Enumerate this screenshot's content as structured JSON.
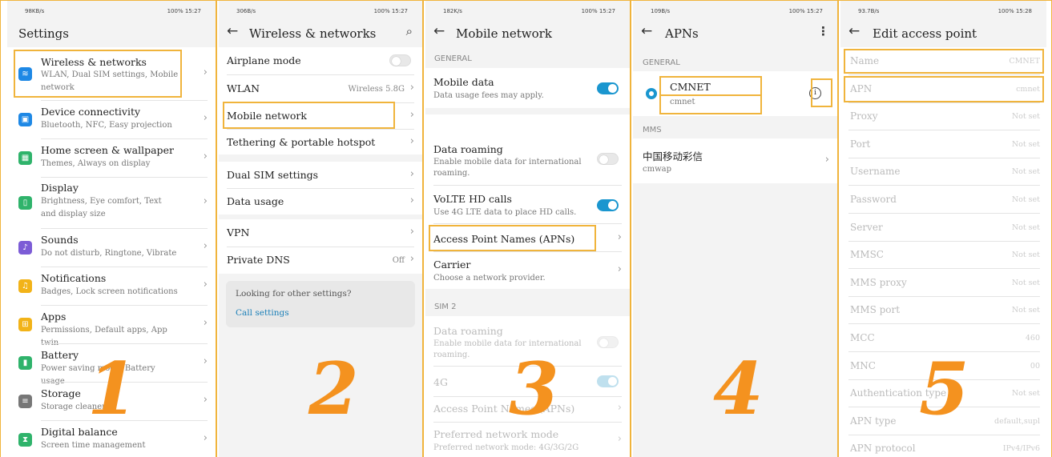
{
  "status_bars": [
    {
      "left": "98KB/s",
      "right": "100% 15:27"
    },
    {
      "left": "306B/s",
      "right": "100% 15:27"
    },
    {
      "left": "182K/s",
      "right": "100% 15:27"
    },
    {
      "left": "109B/s",
      "right": "100% 15:27"
    },
    {
      "left": "93.7B/s",
      "right": "100% 15:28"
    }
  ],
  "step_numbers": [
    "1",
    "2",
    "3",
    "4",
    "5"
  ],
  "settings": {
    "title": "Settings",
    "items": [
      {
        "label": "Wireless & networks",
        "sub": "WLAN, Dual SIM settings, Mobile network",
        "icon": "wifi-icon",
        "color": "#1e88e5",
        "glyph": "≋"
      },
      {
        "label": "Device connectivity",
        "sub": "Bluetooth, NFC, Easy projection",
        "icon": "device-icon",
        "color": "#1e88e5",
        "glyph": "▣"
      },
      {
        "label": "Home screen & wallpaper",
        "sub": "Themes, Always on display",
        "icon": "wallpaper-icon",
        "color": "#2fb36b",
        "glyph": "▦"
      },
      {
        "label": "Display",
        "sub": "Brightness, Eye comfort, Text and display size",
        "icon": "display-icon",
        "color": "#2fb36b",
        "glyph": "▯"
      },
      {
        "label": "Sounds",
        "sub": "Do not disturb, Ringtone, Vibrate",
        "icon": "sound-icon",
        "color": "#7c5cd6",
        "glyph": "♪"
      },
      {
        "label": "Notifications",
        "sub": "Badges, Lock screen notifications",
        "icon": "bell-icon",
        "color": "#f2b318",
        "glyph": "♫"
      },
      {
        "label": "Apps",
        "sub": "Permissions, Default apps, App twin",
        "icon": "apps-icon",
        "color": "#f2b318",
        "glyph": "⊞"
      },
      {
        "label": "Battery",
        "sub": "Power saving mode, Battery usage",
        "icon": "battery-icon",
        "color": "#2fb36b",
        "glyph": "▮"
      },
      {
        "label": "Storage",
        "sub": "Storage cleaner",
        "icon": "storage-icon",
        "color": "#777777",
        "glyph": "≡"
      },
      {
        "label": "Digital balance",
        "sub": "Screen time management",
        "icon": "hourglass-icon",
        "color": "#2fb36b",
        "glyph": "⧗"
      }
    ]
  },
  "wireless": {
    "title": "Wireless & networks",
    "airplane": "Airplane mode",
    "wlan": "WLAN",
    "wlan_value": "Wireless 5.8G",
    "mobile_network": "Mobile network",
    "tethering": "Tethering & portable hotspot",
    "dual_sim": "Dual SIM settings",
    "data_usage": "Data usage",
    "vpn": "VPN",
    "private_dns": "Private DNS",
    "private_dns_value": "Off",
    "looking": "Looking for other settings?",
    "call_settings": "Call settings"
  },
  "mobile": {
    "title": "Mobile network",
    "general": "GENERAL",
    "mobile_data": "Mobile data",
    "mobile_data_sub": "Data usage fees may apply.",
    "data_roaming": "Data roaming",
    "data_roaming_sub": "Enable mobile data for international roaming.",
    "volte": "VoLTE HD calls",
    "volte_sub": "Use 4G LTE data to place HD calls.",
    "apn": "Access Point Names (APNs)",
    "carrier": "Carrier",
    "carrier_sub": "Choose a network provider.",
    "sim2": "SIM 2",
    "roam2": "Data roaming",
    "roam2_sub": "Enable mobile data for international roaming.",
    "g4": "4G",
    "apn2": "Access Point Names (APNs)",
    "pref": "Preferred network mode",
    "pref_sub": "Preferred network mode: 4G/3G/2G"
  },
  "apns": {
    "title": "APNs",
    "general": "GENERAL",
    "name": "CMNET",
    "apn": "cmnet",
    "mms": "MMS",
    "mms_name": "中国移动彩信",
    "mms_apn": "cmwap"
  },
  "edit": {
    "title": "Edit access point",
    "fields": [
      {
        "label": "Name",
        "value": "CMNET"
      },
      {
        "label": "APN",
        "value": "cmnet"
      },
      {
        "label": "Proxy",
        "value": "Not set"
      },
      {
        "label": "Port",
        "value": "Not set"
      },
      {
        "label": "Username",
        "value": "Not set"
      },
      {
        "label": "Password",
        "value": "Not set"
      },
      {
        "label": "Server",
        "value": "Not set"
      },
      {
        "label": "MMSC",
        "value": "Not set"
      },
      {
        "label": "MMS proxy",
        "value": "Not set"
      },
      {
        "label": "MMS port",
        "value": "Not set"
      },
      {
        "label": "MCC",
        "value": "460"
      },
      {
        "label": "MNC",
        "value": "00"
      },
      {
        "label": "Authentication type",
        "value": "Not set"
      },
      {
        "label": "APN type",
        "value": "default,supl"
      },
      {
        "label": "APN protocol",
        "value": "IPv4/IPv6"
      }
    ]
  }
}
